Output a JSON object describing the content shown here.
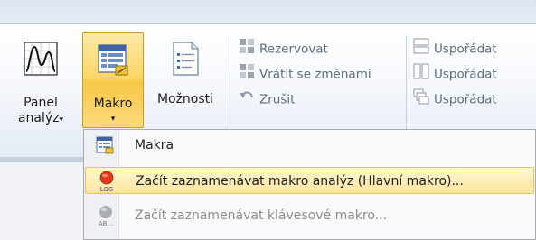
{
  "ribbon": {
    "panel_button": {
      "label_line1": "Panel",
      "label_line2": "analýz",
      "caret": "▾"
    },
    "makro_button": {
      "label": "Makro",
      "caret": "▾"
    },
    "moznosti_button": {
      "label": "Možnosti"
    },
    "column1": [
      {
        "label": "Rezervovat",
        "icon": "reserve-icon"
      },
      {
        "label": "Vrátit se změnami",
        "icon": "return-changes-icon"
      },
      {
        "label": "Zrušit",
        "icon": "undo-icon"
      }
    ],
    "column2": [
      {
        "label": "Uspořádat",
        "icon": "arrange-horizontal-icon"
      },
      {
        "label": "Uspořádat",
        "icon": "arrange-vertical-icon"
      },
      {
        "label": "Uspořádat",
        "icon": "arrange-cascade-icon"
      }
    ]
  },
  "menu": {
    "items": [
      {
        "label": "Makra",
        "icon": "macros-icon",
        "state": "normal"
      },
      {
        "label": "Začít zaznamenávat makro analýz (Hlavní makro)...",
        "icon": "record-log-icon",
        "icon_caption": "LOG",
        "state": "highlighted"
      },
      {
        "label": "Začít zaznamenávat klávesové makro...",
        "icon": "record-keyboard-icon",
        "icon_caption": "AB...",
        "state": "disabled"
      }
    ]
  },
  "colors": {
    "highlight": "#fde59c",
    "record_red": "#e03a1e",
    "disabled_text": "#8d8d8d"
  }
}
